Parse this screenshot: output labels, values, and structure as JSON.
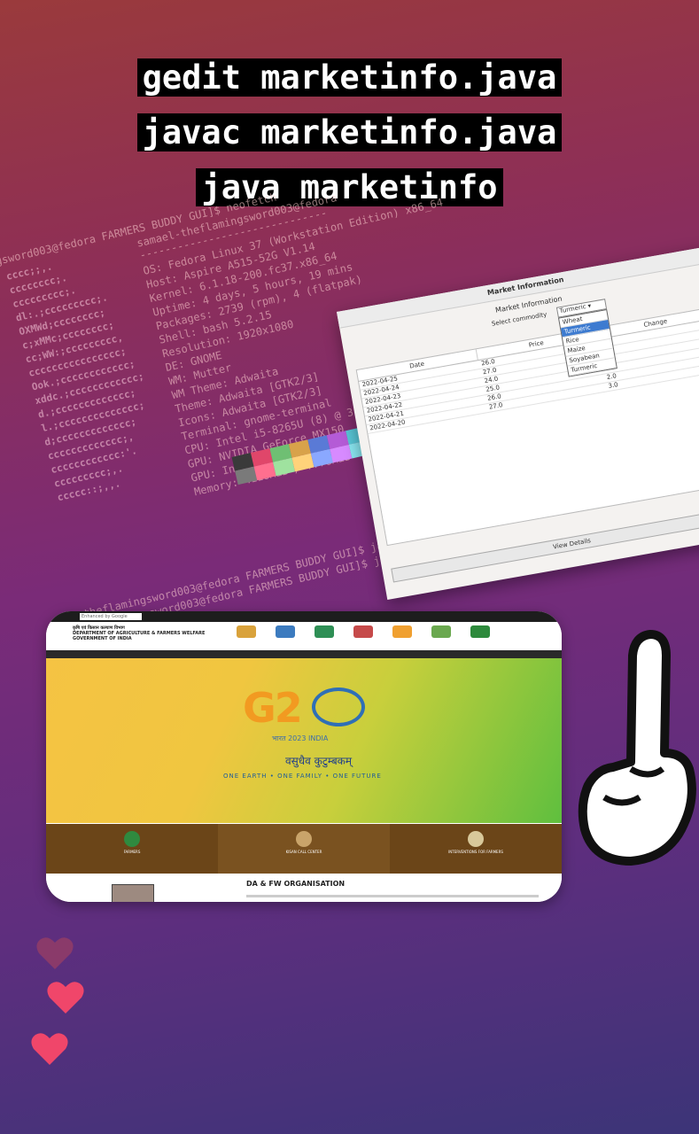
{
  "caption": {
    "line1": "gedit marketinfo.java",
    "line2": "javac marketinfo.java",
    "line3": "java marketinfo"
  },
  "terminal": {
    "prompt_top": "gsword003@fedora FARMERS BUDDY GUI]$ neofetch",
    "user_host": "samael-theflamingsword003@fedora",
    "sep": "------------------------------",
    "info": [
      "OS: Fedora Linux 37 (Workstation Edition) x86_64",
      "Host: Aspire A515-52G V1.14",
      "Kernel: 6.1.18-200.fc37.x86_64",
      "Uptime: 4 days, 5 hours, 19 mins",
      "Packages: 2739 (rpm), 4 (flatpak)",
      "Shell: bash 5.2.15",
      "Resolution: 1920x1080",
      "DE: GNOME",
      "WM: Mutter",
      "WM Theme: Adwaita",
      "Theme: Adwaita [GTK2/3]",
      "Icons: Adwaita [GTK2/3]",
      "Terminal: gnome-terminal",
      "CPU: Intel i5-8265U (8) @ 3.90",
      "GPU: NVIDIA GeForce MX150",
      "GPU: Intel WhiskeyLake-U GT2 [",
      "Memory: 4118MiB / 7778MiB"
    ],
    "ascii": [
      "cccc;;,.",
      "cccccccc;.",
      "ccccccccc;.",
      "dl:.;ccccccccc;.",
      "OXMWd;cccccccc;",
      "c;xMMc;cccccccc;",
      "cc;WW:;ccccccccc,",
      "cccccccccccccccc;",
      "Ook.;cccccccccccc;",
      "xddc.;cccccccccccc;",
      "d.;ccccccccccccc;",
      "l.;cccccccccccccc;",
      "d;ccccccccccccc;",
      "ccccccccccccc;,",
      "cccccccccccc:'.",
      "ccccccccc;,.",
      "ccccc::;,,."
    ],
    "prompt_bottom1": "-theflamingsword003@fedora FARMERS BUDDY GUI]$ java Farme",
    "prompt_bottom2": "-theflamingsword003@fedora FARMERS BUDDY GUI]$ java Marke",
    "palette_colors": [
      "#3a3a3a",
      "#e0466a",
      "#6fbf73",
      "#d8a24a",
      "#5a7ad6",
      "#b45bd6",
      "#58c6d6",
      "#d8d8d8",
      "#7a7a7a",
      "#ff6f8f",
      "#9fe29f",
      "#ffd27a",
      "#8aa8ff",
      "#d78aff",
      "#8ae6f0",
      "#ffffff"
    ]
  },
  "market_window": {
    "title": "Market Information",
    "heading": "Market Information",
    "select_label": "Select commodity",
    "selected": "Turmeric",
    "options": [
      "Wheat",
      "Turmeric",
      "Rice",
      "Maize",
      "Soyabean",
      "Turmeric"
    ],
    "columns": [
      "Date",
      "Price",
      "Change"
    ],
    "rows": [
      [
        "2022-04-25",
        "26.0",
        "5.0"
      ],
      [
        "2022-04-24",
        "27.0",
        "3.0"
      ],
      [
        "2022-04-23",
        "24.0",
        "1.0"
      ],
      [
        "2022-04-22",
        "25.0",
        "0.0"
      ],
      [
        "2022-04-21",
        "26.0",
        "2.0"
      ],
      [
        "2022-04-20",
        "27.0",
        "3.0"
      ]
    ],
    "view_details": "View Details"
  },
  "website": {
    "search_placeholder": "Enhanced by Google",
    "dept_line1": "कृषि एवं किसान कल्याण विभाग",
    "dept_line2": "DEPARTMENT OF AGRICULTURE & FARMERS WELFARE",
    "dept_line3": "GOVERNMENT OF INDIA",
    "hero_g20": "G2",
    "hero_bharat": "भारत 2023 INDIA",
    "hero_sanskrit": "वसुधैव कुटुम्बकम्",
    "hero_tagline": "ONE EARTH • ONE FAMILY • ONE FUTURE",
    "tiles": [
      "FARMERS",
      "KISAN CALL CENTER",
      "INTERVENTIONS FOR FARMERS"
    ],
    "org_title": "DA & FW ORGANISATION",
    "logo_colors": [
      "#d9a23b",
      "#3c7bbf",
      "#2e8f55",
      "#c64a4a",
      "#f0a030",
      "#6aa84f",
      "#2d8a3c"
    ]
  },
  "colors": {
    "heart1": "#8a3a6a",
    "heart2": "#f0466a",
    "heart3": "#f0466a"
  }
}
